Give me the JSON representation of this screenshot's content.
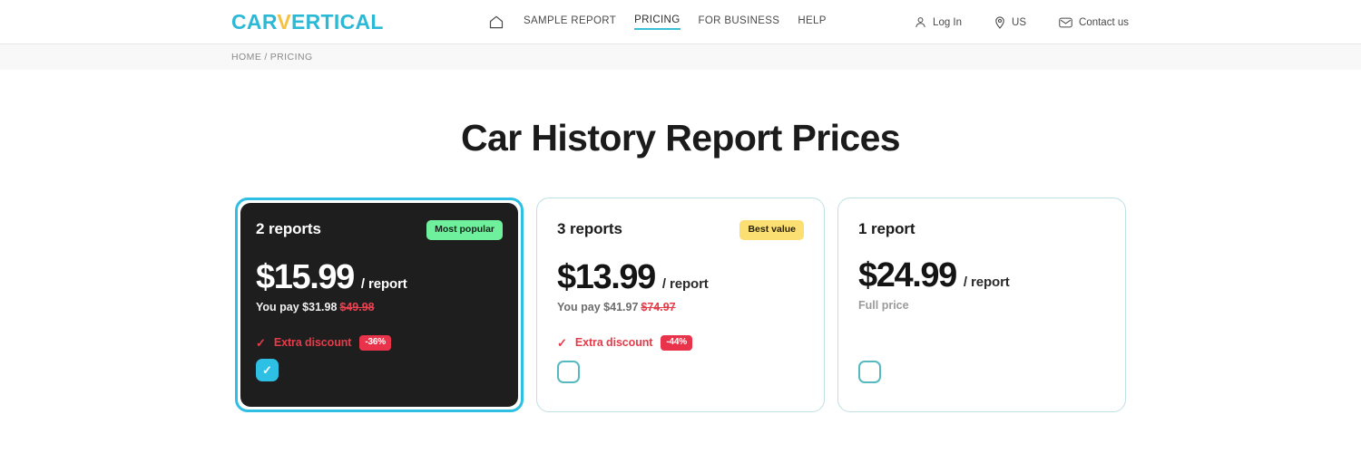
{
  "header": {
    "logo": {
      "prefix": "CAR",
      "accent": "V",
      "suffix": "ERTICAL",
      "accent_color": "#f5c242",
      "brand_color": "#2cb9d6"
    },
    "home_icon": "home-icon",
    "nav": [
      {
        "label": "SAMPLE REPORT",
        "active": false
      },
      {
        "label": "PRICING",
        "active": true
      },
      {
        "label": "FOR BUSINESS",
        "active": false
      },
      {
        "label": "HELP",
        "active": false
      }
    ],
    "right": [
      {
        "label": "Log In",
        "icon": "user-icon"
      },
      {
        "label": "US",
        "icon": "location-pin-icon"
      },
      {
        "label": "Contact us",
        "icon": "envelope-icon"
      }
    ],
    "active_underline_color": "#3bbfd4"
  },
  "breadcrumb": {
    "home": "HOME",
    "separator": "/",
    "current": "PRICING"
  },
  "page": {
    "title": "Car History Report Prices"
  },
  "cards": [
    {
      "name": "2 reports",
      "badge": "Most popular",
      "badge_color": "#6ff09d",
      "price": "$15.99",
      "price_unit": "/ report",
      "you_pay_label": "You pay $31.98",
      "old_price": "$49.98",
      "discount_label": "Extra discount",
      "discount_value": "-36%",
      "selected": true,
      "checkbox_checked": true
    },
    {
      "name": "3 reports",
      "badge": "Best value",
      "badge_color": "#fbdf72",
      "price": "$13.99",
      "price_unit": "/ report",
      "you_pay_label": "You pay $41.97",
      "old_price": "$74.97",
      "discount_label": "Extra discount",
      "discount_value": "-44%",
      "selected": false,
      "checkbox_checked": false
    },
    {
      "name": "1 report",
      "badge": null,
      "price": "$24.99",
      "price_unit": "/ report",
      "full_price_label": "Full price",
      "selected": false,
      "checkbox_checked": false
    }
  ],
  "colors": {
    "brand_cyan": "#2ec0e4",
    "discount_red": "#e33c4a",
    "card_dark": "#1e1e1e",
    "card_border": "#bfe0e2"
  }
}
